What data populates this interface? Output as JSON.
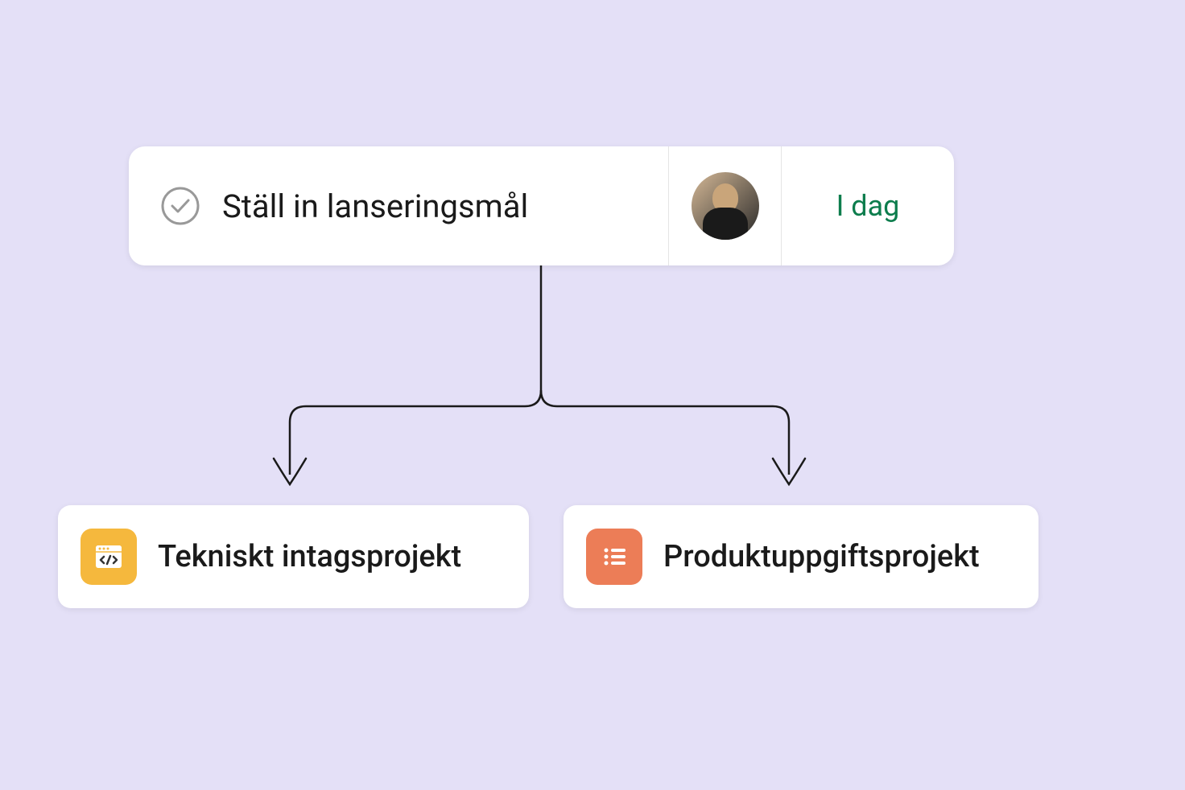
{
  "task": {
    "title": "Ställ in lanseringsmål",
    "date": "I dag"
  },
  "projects": {
    "left": {
      "title": "Tekniskt intagsprojekt",
      "iconColor": "#f5b83d"
    },
    "right": {
      "title": "Produktuppgiftsprojekt",
      "iconColor": "#ec7d57"
    }
  }
}
